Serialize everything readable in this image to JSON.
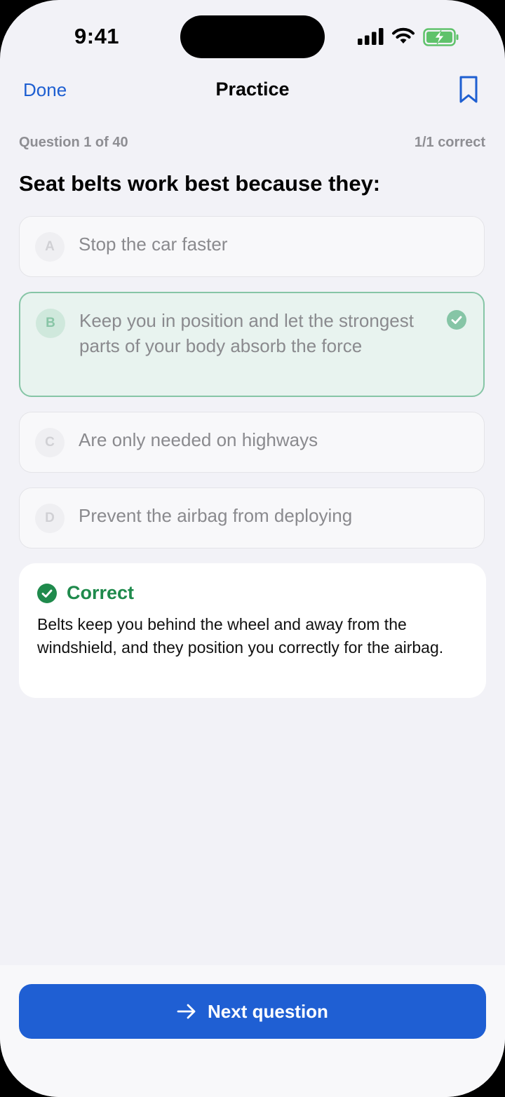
{
  "status_bar": {
    "time": "9:41"
  },
  "nav": {
    "done_label": "Done",
    "title": "Practice"
  },
  "progress": {
    "counter": "Question 1 of 40",
    "score": "1/1 correct"
  },
  "question": {
    "text": "Seat belts work best because they:"
  },
  "options": [
    {
      "letter": "A",
      "text": "Stop the car faster",
      "state": "dimmed"
    },
    {
      "letter": "B",
      "text": "Keep you in position and let the strongest parts of your body absorb the force",
      "state": "correct"
    },
    {
      "letter": "C",
      "text": "Are only needed on highways",
      "state": "dimmed"
    },
    {
      "letter": "D",
      "text": "Prevent the airbag from deploying",
      "state": "dimmed"
    }
  ],
  "feedback": {
    "title": "Correct",
    "explanation": "Belts keep you behind the wheel and away from the windshield, and they position you correctly for the airbag."
  },
  "footer": {
    "next_label": "Next question"
  },
  "colors": {
    "accent": "#1f5fd3",
    "success": "#1f8a4c",
    "correct_bg": "#e8f3ef"
  },
  "icons": [
    "signal-icon",
    "wifi-icon",
    "battery-charging-icon",
    "bookmark-icon",
    "checkmark-circle-icon",
    "arrow-right-icon"
  ]
}
